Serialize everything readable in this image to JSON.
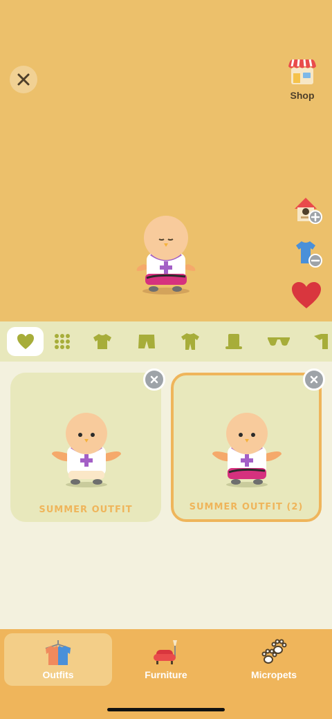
{
  "header": {
    "shop_label": "Shop"
  },
  "icons": {
    "close": "close-icon",
    "shop": "shop-icon",
    "add_home": "house-add-icon",
    "remove_shirt": "shirt-remove-icon",
    "favorite": "heart-icon"
  },
  "categories": [
    {
      "name": "favorites",
      "icon": "heart-icon",
      "active": true
    },
    {
      "name": "all",
      "icon": "grid-dots-icon"
    },
    {
      "name": "tops",
      "icon": "tshirt-icon"
    },
    {
      "name": "bottoms",
      "icon": "shorts-icon"
    },
    {
      "name": "onesies",
      "icon": "jumpsuit-icon"
    },
    {
      "name": "hats",
      "icon": "top-hat-icon"
    },
    {
      "name": "glasses",
      "icon": "sunglasses-icon"
    },
    {
      "name": "more",
      "icon": "partial-item-icon"
    }
  ],
  "outfits": [
    {
      "title": "SUMMER OUTFIT",
      "selected": false
    },
    {
      "title": "SUMMER OUTFIT (2)",
      "selected": true
    }
  ],
  "nav": {
    "outfits_label": "Outfits",
    "furniture_label": "Furniture",
    "micropets_label": "Micropets"
  },
  "colors": {
    "stage_bg": "#ECC06B",
    "category_bar": "#E8E8BC",
    "accent": "#EFB55B",
    "icon_olive": "#A7AD3A",
    "heart_red": "#D9363E"
  }
}
